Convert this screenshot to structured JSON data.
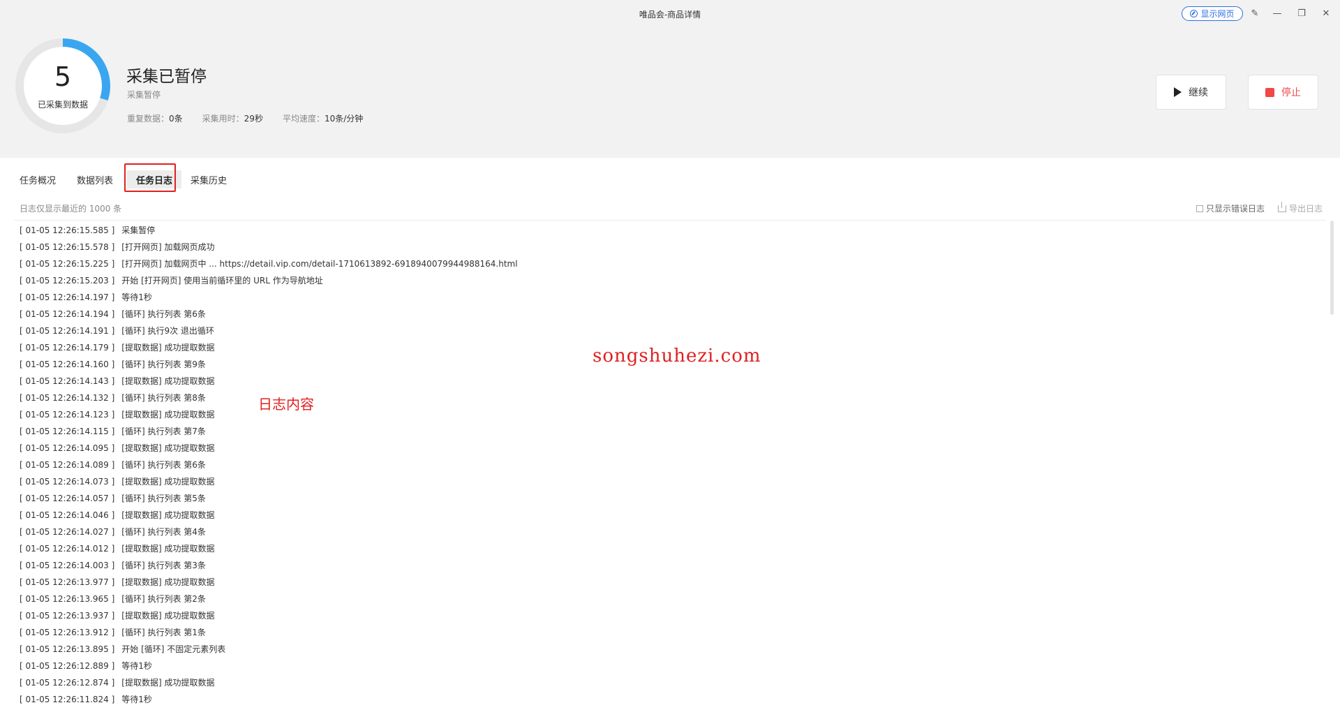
{
  "window": {
    "title": "唯品会-商品详情",
    "show_web_label": "显示网页",
    "controls": [
      "edit-icon",
      "minimize-icon",
      "restore-icon",
      "close-icon"
    ]
  },
  "summary": {
    "count": "5",
    "count_label": "已采集到数据",
    "progress_ring_fraction": 0.3,
    "status_title": "采集已暂停",
    "status_sub": "采集暂停",
    "stats": {
      "dup_label": "重复数据：",
      "dup_value": "0条",
      "time_label": "采集用时：",
      "time_value": "29秒",
      "speed_label": "平均速度：",
      "speed_value": "10条/分钟"
    }
  },
  "actions": {
    "continue_label": "继续",
    "stop_label": "停止"
  },
  "tabs": [
    {
      "label": "任务概况",
      "active": false
    },
    {
      "label": "数据列表",
      "active": false
    },
    {
      "label": "任务日志",
      "active": true
    },
    {
      "label": "采集历史",
      "active": false
    }
  ],
  "log_panel": {
    "note": "日志仅显示最近的 1000 条",
    "error_only_label": "只显示错误日志",
    "export_label": "导出日志",
    "entries": [
      {
        "time": "[ 01-05 12:26:15.585 ]",
        "msg": "采集暂停"
      },
      {
        "time": "[ 01-05 12:26:15.578 ]",
        "msg": "[打开网页] 加载网页成功"
      },
      {
        "time": "[ 01-05 12:26:15.225 ]",
        "msg": "[打开网页] 加载网页中 ... https://detail.vip.com/detail-1710613892-6918940079944988164.html"
      },
      {
        "time": "[ 01-05 12:26:15.203 ]",
        "msg": "开始 [打开网页] 使用当前循环里的 URL 作为导航地址"
      },
      {
        "time": "[ 01-05 12:26:14.197 ]",
        "msg": "等待1秒"
      },
      {
        "time": "[ 01-05 12:26:14.194 ]",
        "msg": "[循环] 执行列表 第6条"
      },
      {
        "time": "[ 01-05 12:26:14.191 ]",
        "msg": "[循环] 执行9次 退出循环"
      },
      {
        "time": "[ 01-05 12:26:14.179 ]",
        "msg": "[提取数据] 成功提取数据"
      },
      {
        "time": "[ 01-05 12:26:14.160 ]",
        "msg": "[循环] 执行列表 第9条"
      },
      {
        "time": "[ 01-05 12:26:14.143 ]",
        "msg": "[提取数据] 成功提取数据"
      },
      {
        "time": "[ 01-05 12:26:14.132 ]",
        "msg": "[循环] 执行列表 第8条"
      },
      {
        "time": "[ 01-05 12:26:14.123 ]",
        "msg": "[提取数据] 成功提取数据"
      },
      {
        "time": "[ 01-05 12:26:14.115 ]",
        "msg": "[循环] 执行列表 第7条"
      },
      {
        "time": "[ 01-05 12:26:14.095 ]",
        "msg": "[提取数据] 成功提取数据"
      },
      {
        "time": "[ 01-05 12:26:14.089 ]",
        "msg": "[循环] 执行列表 第6条"
      },
      {
        "time": "[ 01-05 12:26:14.073 ]",
        "msg": "[提取数据] 成功提取数据"
      },
      {
        "time": "[ 01-05 12:26:14.057 ]",
        "msg": "[循环] 执行列表 第5条"
      },
      {
        "time": "[ 01-05 12:26:14.046 ]",
        "msg": "[提取数据] 成功提取数据"
      },
      {
        "time": "[ 01-05 12:26:14.027 ]",
        "msg": "[循环] 执行列表 第4条"
      },
      {
        "time": "[ 01-05 12:26:14.012 ]",
        "msg": "[提取数据] 成功提取数据"
      },
      {
        "time": "[ 01-05 12:26:14.003 ]",
        "msg": "[循环] 执行列表 第3条"
      },
      {
        "time": "[ 01-05 12:26:13.977 ]",
        "msg": "[提取数据] 成功提取数据"
      },
      {
        "time": "[ 01-05 12:26:13.965 ]",
        "msg": "[循环] 执行列表 第2条"
      },
      {
        "time": "[ 01-05 12:26:13.937 ]",
        "msg": "[提取数据] 成功提取数据"
      },
      {
        "time": "[ 01-05 12:26:13.912 ]",
        "msg": "[循环] 执行列表 第1条"
      },
      {
        "time": "[ 01-05 12:26:13.895 ]",
        "msg": "开始 [循环] 不固定元素列表"
      },
      {
        "time": "[ 01-05 12:26:12.889 ]",
        "msg": "等待1秒"
      },
      {
        "time": "[ 01-05 12:26:12.874 ]",
        "msg": "[提取数据] 成功提取数据"
      },
      {
        "time": "[ 01-05 12:26:11.824 ]",
        "msg": "等待1秒"
      }
    ]
  },
  "overlays": {
    "watermark": "songshuhezi.com",
    "annotation": "日志内容"
  },
  "colors": {
    "accent_blue": "#2f6fe0",
    "ring_progress": "#3aa6f0",
    "stop_red": "#f04848",
    "highlight_red": "#e02020"
  }
}
